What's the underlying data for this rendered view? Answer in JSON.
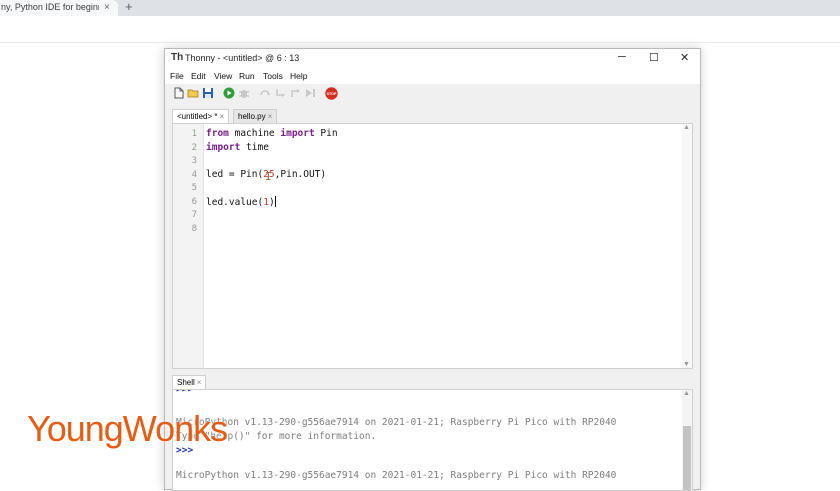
{
  "browser": {
    "tab_title": "ny, Python IDE for beginne",
    "tab_close": "×",
    "new_tab": "+"
  },
  "window": {
    "title": "Thonny  -  <untitled>  @  6 : 13",
    "minimize": "─",
    "maximize": "☐",
    "close": "✕"
  },
  "menu": [
    "File",
    "Edit",
    "View",
    "Run",
    "Tools",
    "Help"
  ],
  "toolbar": {
    "icons": [
      "new-file-icon",
      "open-folder-icon",
      "save-icon",
      "run-icon",
      "debug-icon",
      "step-over-icon",
      "step-into-icon",
      "step-out-icon",
      "resume-icon",
      "stop-icon"
    ],
    "stop_label": "STOP",
    "colors": {
      "run": "#2e9d3a",
      "stop": "#d62d20",
      "save": "#2a5fb5"
    }
  },
  "editor_tabs": [
    {
      "label": "<untitled> *",
      "close": "×"
    },
    {
      "label": "hello.py",
      "close": "×"
    }
  ],
  "editor": {
    "line_numbers": [
      "1",
      "2",
      "3",
      "4",
      "5",
      "6",
      "7",
      "8"
    ],
    "lines": {
      "l1": {
        "kw1": "from",
        "t1": " machine ",
        "kw2": "import",
        "t2": " Pin"
      },
      "l2": {
        "kw1": "import",
        "t1": " time"
      },
      "l4": {
        "pre": "led = Pin(",
        "num": "25",
        "post": ",Pin.OUT)"
      },
      "l6": {
        "pre": "led.value(",
        "num": "1",
        "post": ")"
      }
    },
    "colors": {
      "keyword": "#7a1f8e",
      "number": "#c0392b"
    }
  },
  "shell": {
    "tab_label": "Shell",
    "tab_close": "×",
    "lines": {
      "s0": ">>>",
      "s1": "MicroPython v1.13-290-g556ae7914 on 2021-01-21; Raspberry Pi Pico with RP2040",
      "s2": "Type \"help()\" for more information.",
      "s3": ">>>",
      "s4": "MicroPython v1.13-290-g556ae7914 on 2021-01-21; Raspberry Pi Pico with RP2040"
    }
  },
  "watermark": {
    "text": "YoungWonks",
    "color": "#e65c12"
  }
}
